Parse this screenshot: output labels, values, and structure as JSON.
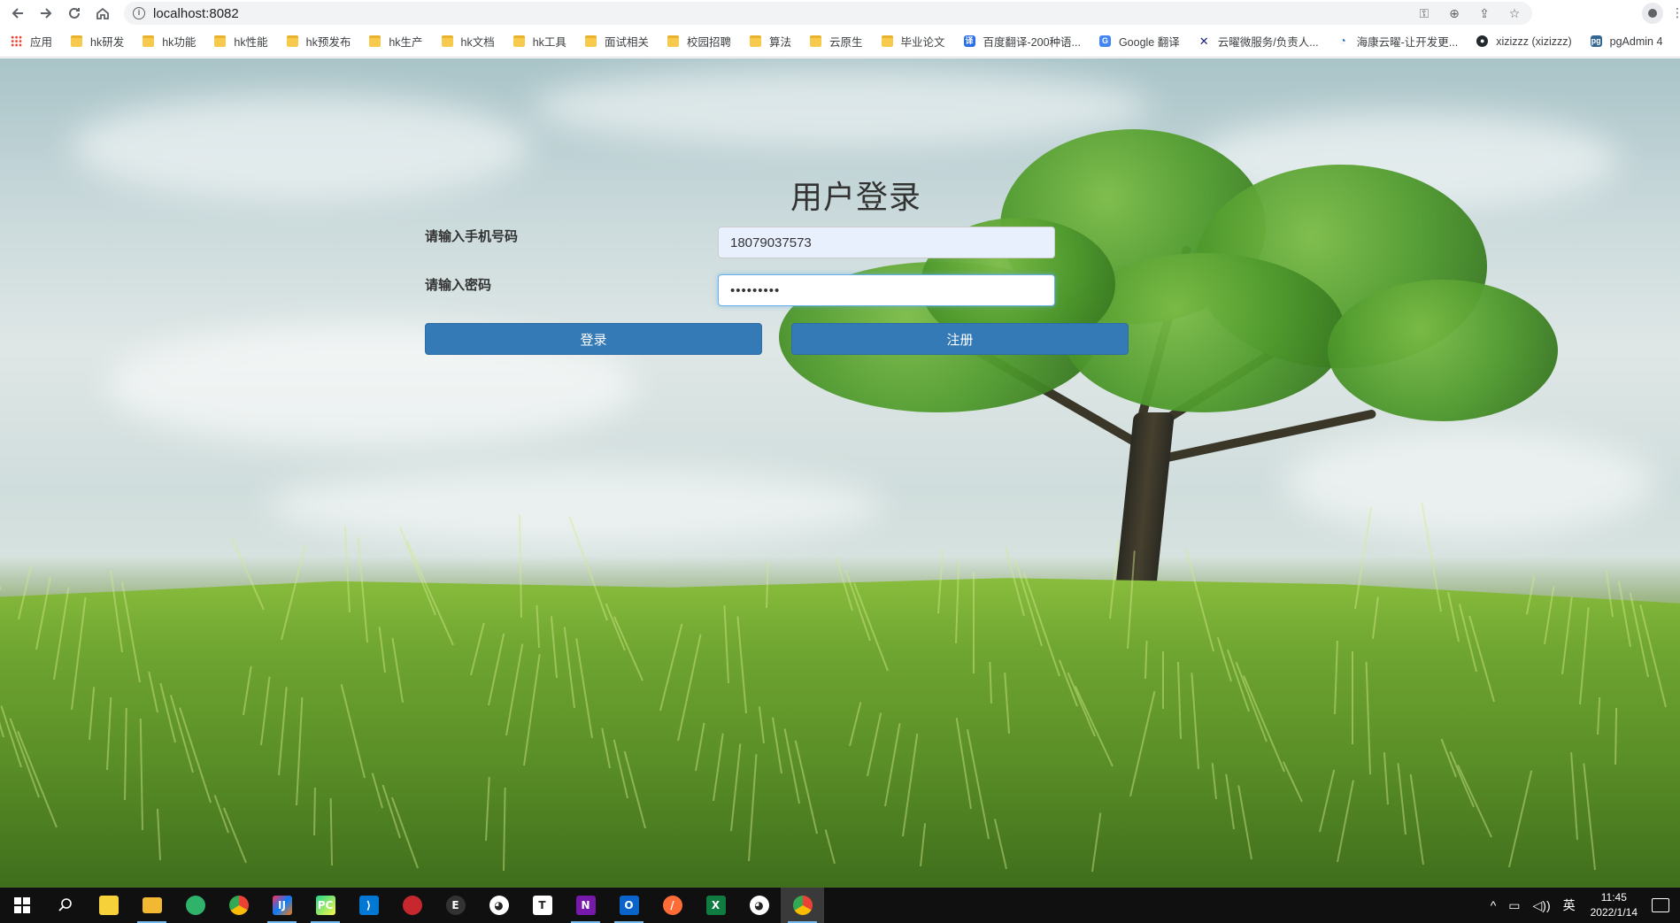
{
  "browser": {
    "url": "localhost:8082",
    "bookmarks": [
      {
        "label": "应用",
        "icon": "apps-grid-icon"
      },
      {
        "label": "hk研发",
        "icon": "folder-icon"
      },
      {
        "label": "hk功能",
        "icon": "folder-icon"
      },
      {
        "label": "hk性能",
        "icon": "folder-icon"
      },
      {
        "label": "hk预发布",
        "icon": "folder-icon"
      },
      {
        "label": "hk生产",
        "icon": "folder-icon"
      },
      {
        "label": "hk文档",
        "icon": "folder-icon"
      },
      {
        "label": "hk工具",
        "icon": "folder-icon"
      },
      {
        "label": "面试相关",
        "icon": "folder-icon"
      },
      {
        "label": "校园招聘",
        "icon": "folder-icon"
      },
      {
        "label": "算法",
        "icon": "folder-icon"
      },
      {
        "label": "云原生",
        "icon": "folder-icon"
      },
      {
        "label": "毕业论文",
        "icon": "folder-icon"
      },
      {
        "label": "百度翻译-200种语...",
        "icon": "baidu-translate-icon"
      },
      {
        "label": "Google 翻译",
        "icon": "google-translate-icon"
      },
      {
        "label": "云曜微服务/负责人...",
        "icon": "xmark-logo-icon"
      },
      {
        "label": "海康云曜-让开发更...",
        "icon": "hikcloud-icon"
      },
      {
        "label": "xizizzz (xizizzz)",
        "icon": "github-icon"
      },
      {
        "label": "pgAdmin 4",
        "icon": "pgadmin-icon"
      }
    ]
  },
  "login": {
    "title": "用户登录",
    "phone_label": "请输入手机号码",
    "phone_value": "18079037573",
    "password_label": "请输入密码",
    "password_value": "•••••••••",
    "login_button": "登录",
    "register_button": "注册"
  },
  "taskbar": {
    "time": "11:45",
    "date": "2022/1/14",
    "ime": "英"
  },
  "colors": {
    "primary_button": "#337ab7",
    "autofill_bg": "#e8f0fe",
    "taskbar_bg": "#101010"
  }
}
